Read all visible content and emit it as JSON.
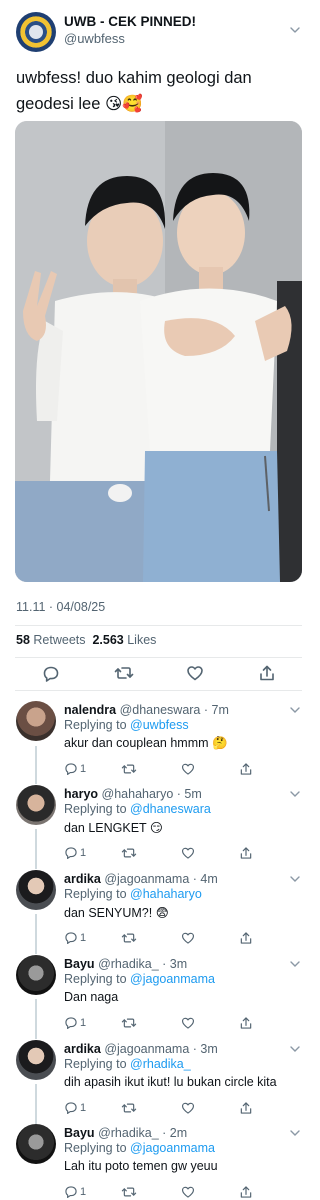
{
  "tweet": {
    "display_name": "UWB - CEK PINNED!",
    "handle": "@uwbfess",
    "text": "uwbfess! duo kahim geologi dan geodesi lee 😘🥰",
    "timestamp": "11.11 · 04/08/25",
    "retweets_count": "58",
    "retweets_label": "Retweets",
    "likes_count": "2.563",
    "likes_label": "Likes"
  },
  "replies": [
    {
      "name": "nalendra",
      "meta": "@dhaneswara · 7m",
      "replying_prefix": "Replying to",
      "replying_to": "@uwbfess",
      "text": "akur dan couplean hmmm 🤔",
      "reply_count": "1"
    },
    {
      "name": "haryo",
      "meta": "@hahaharyo · 5m",
      "replying_prefix": "Replying to",
      "replying_to": "@dhaneswara",
      "text": "dan LENGKET 😏",
      "reply_count": "1"
    },
    {
      "name": "ardika",
      "meta": "@jagoanmama · 4m",
      "replying_prefix": "Replying to",
      "replying_to": "@hahaharyo",
      "text": "dan SENYUM?! 😨",
      "reply_count": "1"
    },
    {
      "name": "Bayu",
      "meta": "@rhadika_ · 3m",
      "replying_prefix": "Replying to",
      "replying_to": "@jagoanmama",
      "text": "Dan naga",
      "reply_count": "1"
    },
    {
      "name": "ardika",
      "meta": "@jagoanmama · 3m",
      "replying_prefix": "Replying to",
      "replying_to": "@rhadika_",
      "text": "dih apasih ikut ikut! lu bukan circle kita",
      "reply_count": "1"
    },
    {
      "name": "Bayu",
      "meta": "@rhadika_ · 2m",
      "replying_prefix": "Replying to",
      "replying_to": "@jagoanmama",
      "text": "Lah itu poto temen gw yeuu",
      "reply_count": "1"
    }
  ],
  "icons": {
    "reply": "reply-icon",
    "retweet": "retweet-icon",
    "like": "heart-icon",
    "share": "share-icon",
    "menu": "chevron-down-icon"
  },
  "colors": {
    "link": "#1d9bf0",
    "secondary_text": "#536471",
    "primary_text": "#0f1419",
    "divider": "#e7e9ea"
  }
}
